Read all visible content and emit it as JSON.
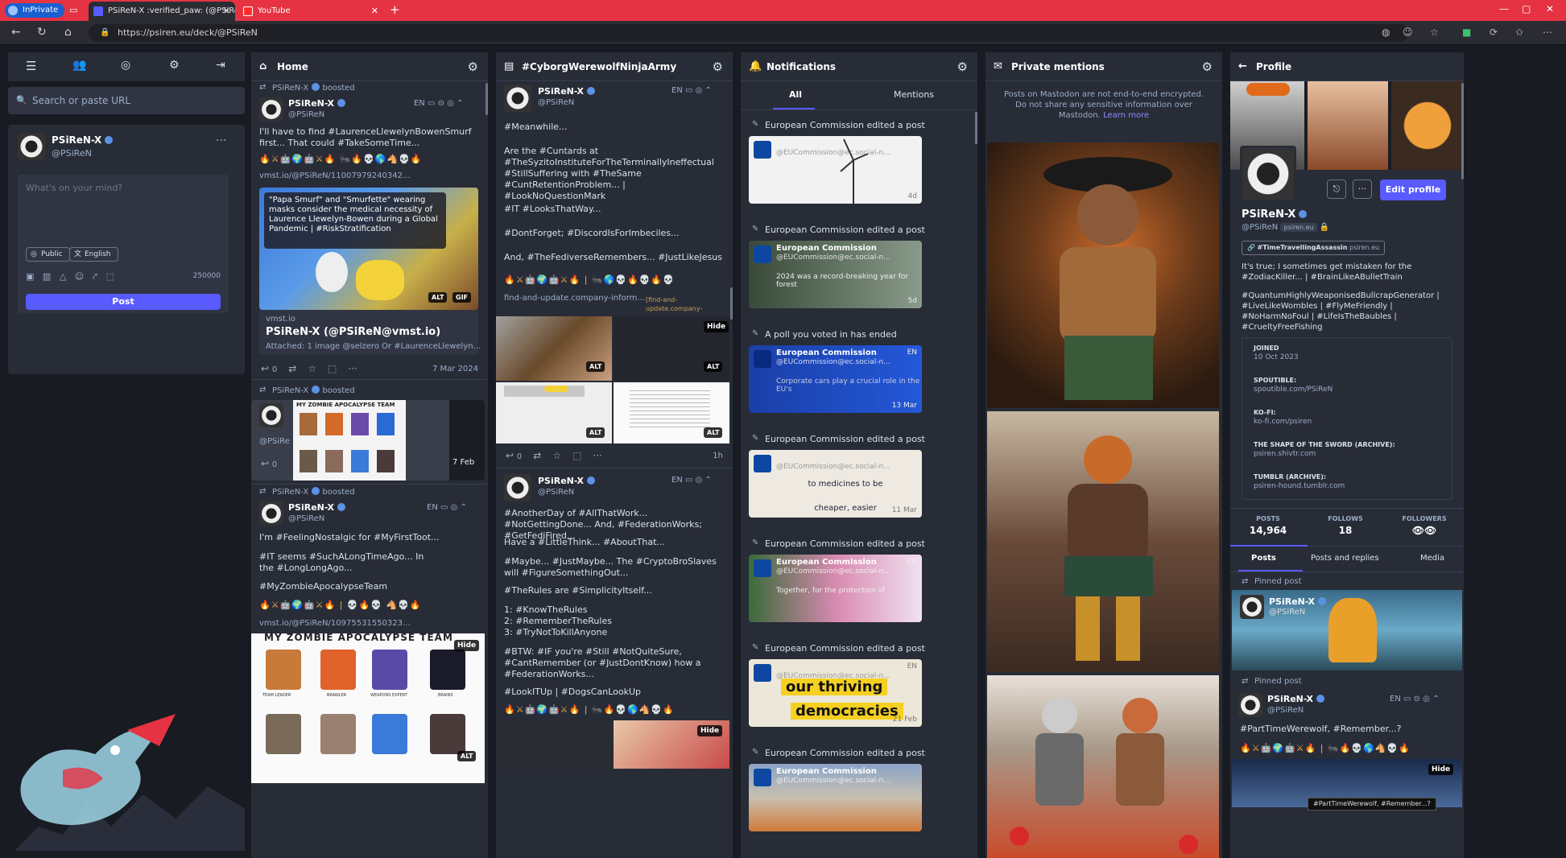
{
  "browser": {
    "inprivate_label": "InPrivate",
    "tabs": [
      {
        "label": "PSiReN-X :verified_paw: (@PSiRe..."
      },
      {
        "label": "YouTube"
      }
    ],
    "new_tab": "+",
    "url": "https://psiren.eu/deck/@PSiReN"
  },
  "nav": {
    "search_placeholder": "Search or paste URL"
  },
  "account": {
    "display_name": "PSiReN-X",
    "username": "@PSiReN",
    "more": "···"
  },
  "compose": {
    "placeholder": "What's on your mind?",
    "visibility": "Public",
    "language": "English",
    "char_count": "250000",
    "post_label": "Post"
  },
  "home": {
    "title": "Home",
    "posts": [
      {
        "boosted_by": "PSiReN-X",
        "boosted_suffix": "boosted",
        "name": "PSiReN-X",
        "user": "@PSiReN",
        "lang": "EN",
        "text1": "I'll have to find #LaurenceLlewelynBowenSmurf first... That could #TakeSomeTime...",
        "emoji": "🔥⚔🤖🌍🤖⚔🔥 🐜🔥💀🌎🐴💀🔥",
        "link": "vmst.io/@PSiReN/11007979240342...",
        "image_caption": "\"Papa Smurf\" and \"Smurfette\" wearing masks consider the medical necessity of Laurence Llewelyn-Bowen during a Global Pandemic | #RiskStratification",
        "alt": "ALT",
        "gif": "GIF",
        "card_site": "vmst.io",
        "card_title": "PSiReN-X (@PSiReN@vmst.io)",
        "card_desc": "Attached: 1 image @selzero Or #LaurenceLlewelyn...",
        "reply_count": "0",
        "date": "7 Mar 2024"
      },
      {
        "boosted_by": "PSiReN-X",
        "boosted_suffix": "boosted",
        "preview_title": "MY ZOMBIE APOCALYPSE TEAM",
        "user": "@PSiRe",
        "reply_count": "0",
        "date": "7 Feb"
      },
      {
        "boosted_by": "PSiReN-X",
        "boosted_suffix": "boosted",
        "name": "PSiReN-X",
        "user": "@PSiReN",
        "lang": "EN",
        "text1": "I'm #FeelingNostalgic for #MyFirstToot...",
        "text2": "#IT seems #SuchALongTimeAgo... In the #LongLongAgo...",
        "text3": "#MyZombieApocalypseTeam",
        "emoji": "🔥⚔🤖🌍🤖⚔🔥 | 💀🔥💀 🐴💀🔥",
        "link": "vmst.io/@PSiReN/10975531550323...",
        "image_title": "MY ZOMBIE APOCALYPSE TEAM",
        "image_labels": [
          "TEAM LEADER",
          "BRAWLER",
          "WEAPONS EXPERT",
          "BRAINS"
        ],
        "hide": "Hide",
        "alt": "ALT"
      }
    ]
  },
  "hashtag": {
    "title": "#CyborgWerewolfNinjaArmy",
    "posts": [
      {
        "name": "PSiReN-X",
        "user": "@PSiReN",
        "lang": "EN",
        "lines": [
          "#Meanwhile...",
          "Are the #Cuntards at #TheSyzitoInstituteForTheTerminallyIneffectual #StillSuffering with #TheSame #CuntRetentionProblem... | #LookNoQuestionMark",
          "#IT #LooksThatWay...",
          "#DontForget; #DiscordIsForImbeciles...",
          "And, #TheFediverseRemembers... #JustLikeJesus"
        ],
        "emoji": "🔥⚔🤖🌍🤖⚔🔥 | 🐜🌎💀🔥💀🔥💀",
        "link": "find-and-update.company-inform...",
        "link_hint": "[find-and-update.company-information.service.gov.uk]",
        "hide": "Hide",
        "alt": "ALT",
        "reply_count": "0",
        "time": "1h"
      },
      {
        "name": "PSiReN-X",
        "user": "@PSiReN",
        "lang": "EN",
        "lines": [
          "#AnotherDay of #AllThatWork... #NotGettingDone... And, #FederationWorks; #GetFediFired...",
          "Have a #LittleThink... #AboutThat...",
          "#Maybe... #JustMaybe... The #CryptoBroSlaves will #FigureSomethingOut...",
          "#TheRules are #SimplicityItself...",
          "1: #KnowTheRules\n2: #RememberTheRules\n3: #TryNotToKillAnyone",
          "#BTW: #IF you're #Still #NotQuiteSure, #CantRemember (or #JustDontKnow) how a #FederationWorks...",
          "#LookITUp | #DogsCanLookUp"
        ],
        "emoji": "🔥⚔🤖🌍🤖⚔🔥 | 🐜🔥💀🌎🐴💀🔥",
        "hide": "Hide"
      }
    ]
  },
  "notifications": {
    "title": "Notifications",
    "tabs": [
      "All",
      "Mentions"
    ],
    "items": [
      {
        "type": "edited",
        "line": "European Commission edited a post",
        "name": "",
        "user": "@EUCommission@ec.social-n...",
        "time": "4d",
        "card": "#f2f2f2"
      },
      {
        "type": "edited",
        "line": "European Commission edited a post",
        "name": "European Commission",
        "user": "@EUCommission@ec.social-n...",
        "extra": "2024 was a record-breaking year for forest",
        "time": "5d",
        "card": "#6b7a6a"
      },
      {
        "type": "poll",
        "line": "A poll you voted in has ended",
        "name": "European Commission",
        "user": "@EUCommission@ec.social-n...",
        "extra": "Corporate cars play a crucial role in the EU's",
        "time": "13 Mar",
        "lang": "EN",
        "card": "#1546b8"
      },
      {
        "type": "edited",
        "line": "European Commission edited a post",
        "name": "",
        "user": "@EUCommission@ec.social-n...",
        "extra": "to medicines to be cheaper, easier",
        "time": "11 Mar",
        "card": "#eeeae2"
      },
      {
        "type": "edited",
        "line": "European Commission edited a post",
        "name": "European Commission",
        "user": "@EUCommission@ec.social-n...",
        "extra": "Together, for the protection of",
        "lang": "EN",
        "card": "#b86a8a"
      },
      {
        "type": "edited",
        "line": "European Commission edited a post",
        "name": "",
        "user": "@EUCommission@ec.social-n...",
        "extra1": "our thriving",
        "extra2": "democracies",
        "time": "21 Feb",
        "lang": "EN",
        "card": "#ece7d8"
      },
      {
        "type": "edited",
        "line": "European Commission edited a post",
        "name": "European Commission",
        "user": "@EUCommission@ec.social-n...",
        "card": "#7a8ea8"
      }
    ]
  },
  "private_mentions": {
    "title": "Private mentions",
    "notice": "Posts on Mastodon are not end-to-end encrypted. Do not share any sensitive information over Mastodon.",
    "learn_more": "Learn more"
  },
  "profile": {
    "title": "Profile",
    "edit_label": "Edit profile",
    "display_name": "PSiReN-X",
    "username": "@PSiReN",
    "domain_badge": "psiren.eu",
    "featured_tag": "#TimeTravellingAssassin",
    "featured_domain": "psiren.eu",
    "bio": [
      "It's true; I sometimes get mistaken for the #ZodiacKiller... | #BrainLikeABulletTrain",
      "#QuantumHighlyWeaponisedBullcrapGenerator | #LiveLikeWombles | #FlyMeFriendly | #NoHarmNoFoul | #LifeIsTheBaubles | #CrueltyFreeFishing"
    ],
    "fields": [
      {
        "label": "JOINED",
        "value": "10 Oct 2023"
      },
      {
        "label": "SPOUTIBLE:",
        "value": "spoutible.com/PSiReN"
      },
      {
        "label": "KO-FI:",
        "value": "ko-fi.com/psiren"
      },
      {
        "label": "THE SHAPE OF THE SWORD (ARCHIVE):",
        "value": "psiren.shivtr.com"
      },
      {
        "label": "TUMBLR (ARCHIVE):",
        "value": "psiren-hound.tumblr.com"
      }
    ],
    "stats": [
      {
        "label": "POSTS",
        "value": "14,964"
      },
      {
        "label": "FOLLOWS",
        "value": "18"
      },
      {
        "label": "FOLLOWERS",
        "value": "👁👁"
      }
    ],
    "tabs": [
      "Posts",
      "Posts and replies",
      "Media"
    ],
    "pinned_label": "Pinned post",
    "pinned": [
      {
        "name": "PSiReN-X",
        "user": "@PSiReN"
      },
      {
        "name": "PSiReN-X",
        "user": "@PSiReN",
        "lang": "EN",
        "text": "#PartTimeWerewolf, #Remember...?",
        "emoji": "🔥⚔🤖🌍🤖⚔🔥 | 🐜🔥💀🌎🐴💀🔥",
        "hide": "Hide"
      }
    ],
    "tooltip": "#PartTimeWerewolf, #Remember...?"
  },
  "colors": {
    "accent": "#595aff",
    "column_bg": "#282c37",
    "deck_bg": "#191b22",
    "browser_red": "#e53343"
  }
}
